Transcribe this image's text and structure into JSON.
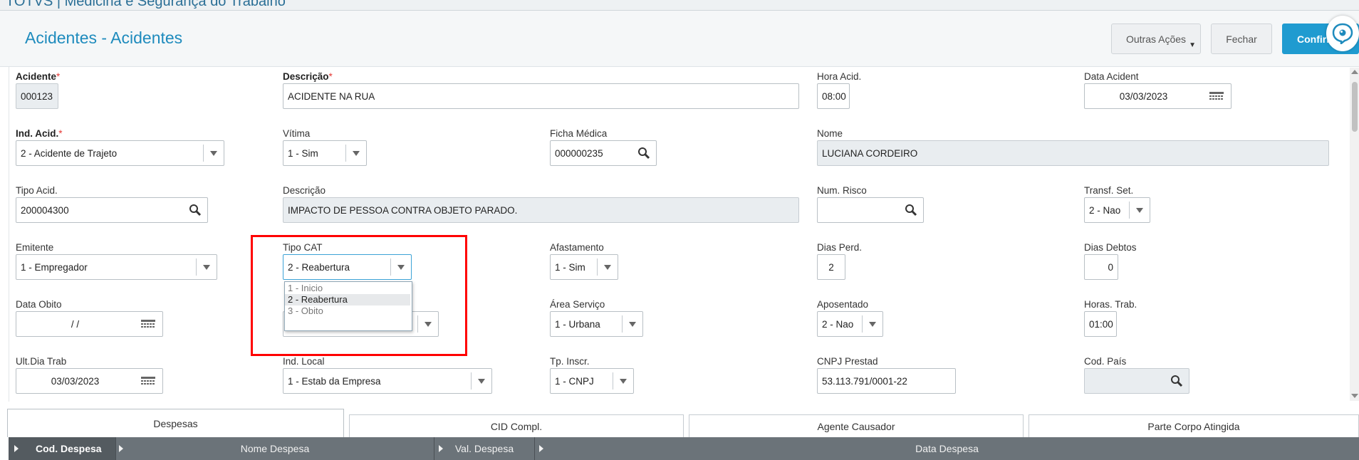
{
  "app": {
    "title": "TOTVS | Medicina e Segurança do Trabalho"
  },
  "header": {
    "page_title": "Acidentes - Acidentes",
    "buttons": {
      "outras": "Outras Ações",
      "fechar": "Fechar",
      "confirmar": "Confirm"
    }
  },
  "form": {
    "acidente": {
      "label": "Acidente",
      "value": "000123"
    },
    "descricao": {
      "label": "Descrição",
      "value": "ACIDENTE NA RUA"
    },
    "hora_acid": {
      "label": "Hora Acid.",
      "value": "08:00"
    },
    "data_acident": {
      "label": "Data Acident",
      "value": "03/03/2023"
    },
    "ind_acid": {
      "label": "Ind. Acid.",
      "value": "2 - Acidente de Trajeto"
    },
    "vitima": {
      "label": "Vítima",
      "value": "1 - Sim"
    },
    "ficha_medica": {
      "label": "Ficha Médica",
      "value": "000000235"
    },
    "nome": {
      "label": "Nome",
      "value": "LUCIANA CORDEIRO"
    },
    "tipo_acid": {
      "label": "Tipo Acid.",
      "value": "200004300"
    },
    "descricao2": {
      "label": "Descrição",
      "value": "IMPACTO DE PESSOA CONTRA OBJETO PARADO."
    },
    "num_risco": {
      "label": "Num. Risco",
      "value": ""
    },
    "transf_set": {
      "label": "Transf. Set.",
      "value": "2 - Nao"
    },
    "emitente": {
      "label": "Emitente",
      "value": "1 - Empregador"
    },
    "tipo_cat": {
      "label": "Tipo CAT",
      "value": "2 - Reabertura",
      "options": [
        "1 - Inicio",
        "2 - Reabertura",
        "3 - Obito"
      ]
    },
    "afastamento": {
      "label": "Afastamento",
      "value": "1 - Sim"
    },
    "dias_perd": {
      "label": "Dias Perd.",
      "value": "2"
    },
    "dias_debtos": {
      "label": "Dias Debtos",
      "value": "0"
    },
    "data_obito": {
      "label": "Data Obito",
      "value": "/ /"
    },
    "area_servico": {
      "label": "Área Serviço",
      "value": "1 - Urbana"
    },
    "aposentado": {
      "label": "Aposentado",
      "value": "2 - Nao"
    },
    "horas_trab": {
      "label": "Horas. Trab.",
      "value": "01:00"
    },
    "ult_dia_trab": {
      "label": "Ult.Dia Trab",
      "value": "03/03/2023"
    },
    "ind_local": {
      "label": "Ind. Local",
      "value": "1 - Estab da Empresa"
    },
    "tp_inscr": {
      "label": "Tp. Inscr.",
      "value": "1 - CNPJ"
    },
    "cnpj_prestad": {
      "label": "CNPJ Prestad",
      "value": "53.113.791/0001-22"
    },
    "cod_pais": {
      "label": "Cod. País",
      "value": ""
    }
  },
  "tabs": [
    "Despesas",
    "CID Compl.",
    "Agente Causador",
    "Parte Corpo Atingida"
  ],
  "grid": {
    "columns": [
      "Cod. Despesa",
      "Nome Despesa",
      "Val. Despesa",
      "Data Despesa"
    ]
  },
  "colors": {
    "accent": "#1e8bbd",
    "confirm": "#1f9bd0",
    "highlight": "#ff0000"
  },
  "icons": [
    "search-icon",
    "calendar-icon",
    "chevron-down-icon",
    "help-chat-icon"
  ]
}
